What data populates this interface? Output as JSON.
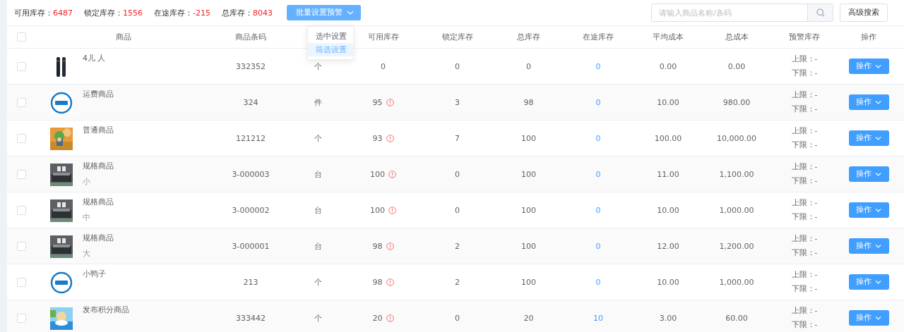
{
  "summary": [
    {
      "label": "可用库存：",
      "value": "6487"
    },
    {
      "label": "锁定库存：",
      "value": "1556"
    },
    {
      "label": "在途库存：",
      "value": "-215"
    },
    {
      "label": "总库存：",
      "value": "8043"
    }
  ],
  "batch_button": {
    "label": "批量设置预警",
    "expanded": true
  },
  "batch_menu": [
    {
      "label": "选中设置",
      "selected": false
    },
    {
      "label": "筛选设置",
      "selected": true
    }
  ],
  "search": {
    "placeholder": "请输入商品名称/条码"
  },
  "advanced_search": "高级搜索",
  "table": {
    "select_all": {
      "checked": false
    },
    "columns": [
      "商品",
      "商品条码",
      "",
      "可用库存",
      "锁定库存",
      "总库存",
      "在途库存",
      "平均成本",
      "总成本",
      "预警库存",
      "操作"
    ],
    "rows": [
      {
        "checked": false,
        "name": "4儿 人",
        "spec": "",
        "barcode": "332352",
        "unit": "个",
        "available": "0",
        "warning": false,
        "locked": "0",
        "total": "0",
        "transit": "0",
        "avg_cost": "0.00",
        "total_cost": "0.00",
        "upper": "上限：-",
        "lower": "下限：-",
        "action": "操作"
      },
      {
        "checked": false,
        "name": "运费商品",
        "spec": "",
        "barcode": "324",
        "unit": "件",
        "available": "95",
        "warning": true,
        "locked": "3",
        "total": "98",
        "transit": "0",
        "avg_cost": "10.00",
        "total_cost": "980.00",
        "upper": "上限：-",
        "lower": "下限：-",
        "action": "操作"
      },
      {
        "checked": false,
        "name": "普通商品",
        "spec": "",
        "barcode": "121212",
        "unit": "个",
        "available": "93",
        "warning": true,
        "locked": "7",
        "total": "100",
        "transit": "0",
        "avg_cost": "100.00",
        "total_cost": "10,000.00",
        "upper": "上限：-",
        "lower": "下限：-",
        "action": "操作"
      },
      {
        "checked": false,
        "name": "规格商品",
        "spec": "小",
        "barcode": "3-000003",
        "unit": "台",
        "available": "100",
        "warning": true,
        "locked": "0",
        "total": "100",
        "transit": "0",
        "avg_cost": "11.00",
        "total_cost": "1,100.00",
        "upper": "上限：-",
        "lower": "下限：-",
        "action": "操作"
      },
      {
        "checked": false,
        "name": "规格商品",
        "spec": "中",
        "barcode": "3-000002",
        "unit": "台",
        "available": "100",
        "warning": true,
        "locked": "0",
        "total": "100",
        "transit": "0",
        "avg_cost": "10.00",
        "total_cost": "1,000.00",
        "upper": "上限：-",
        "lower": "下限：-",
        "action": "操作"
      },
      {
        "checked": false,
        "name": "规格商品",
        "spec": "大",
        "barcode": "3-000001",
        "unit": "台",
        "available": "98",
        "warning": true,
        "locked": "2",
        "total": "100",
        "transit": "0",
        "avg_cost": "12.00",
        "total_cost": "1,200.00",
        "upper": "上限：-",
        "lower": "下限：-",
        "action": "操作"
      },
      {
        "checked": false,
        "name": "小鸭子",
        "spec": "",
        "barcode": "213",
        "unit": "个",
        "available": "98",
        "warning": true,
        "locked": "2",
        "total": "100",
        "transit": "0",
        "avg_cost": "10.00",
        "total_cost": "1,000.00",
        "upper": "上限：-",
        "lower": "下限：-",
        "action": "操作"
      },
      {
        "checked": false,
        "name": "发布积分商品",
        "spec": "",
        "barcode": "333442",
        "unit": "个",
        "available": "20",
        "warning": true,
        "locked": "0",
        "total": "20",
        "transit": "10",
        "avg_cost": "3.00",
        "total_cost": "60.00",
        "upper": "上限：-",
        "lower": "下限：-",
        "action": "操作"
      }
    ]
  }
}
